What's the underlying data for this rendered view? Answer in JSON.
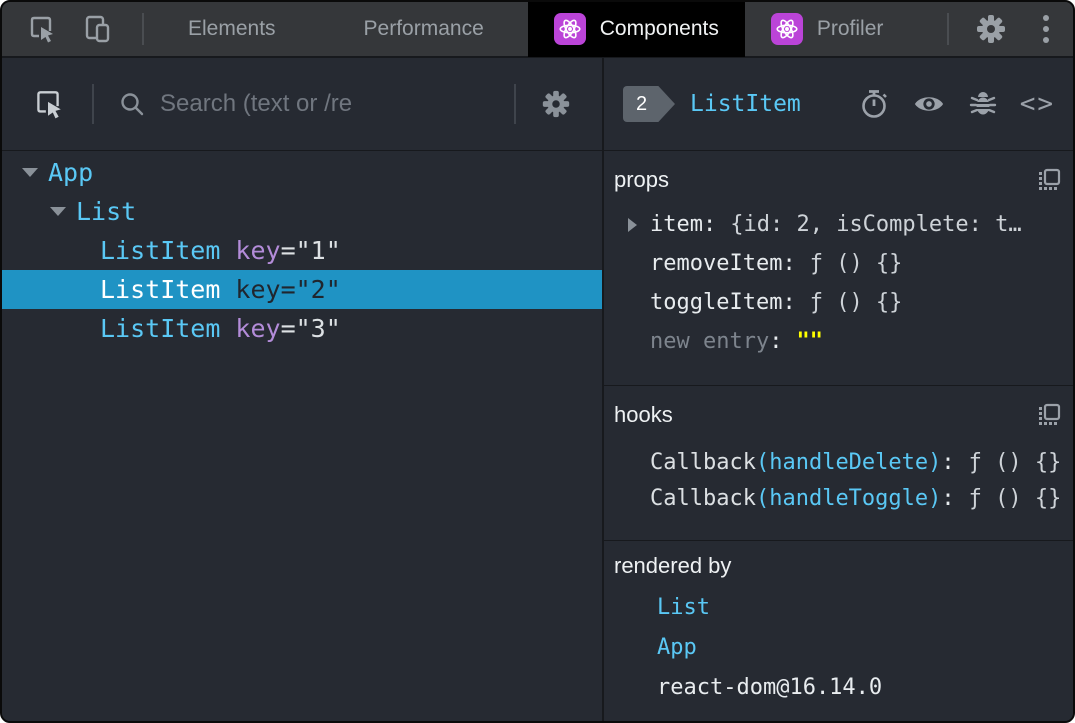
{
  "topbar": {
    "tabs": [
      {
        "label": "Elements"
      },
      {
        "label": "Performance"
      },
      {
        "label": "Components"
      },
      {
        "label": "Profiler"
      }
    ]
  },
  "left_panel": {
    "search_placeholder": "Search (text or /re",
    "tree": [
      {
        "label": "App"
      },
      {
        "label": "List"
      },
      {
        "label": "ListItem",
        "key_name": "key",
        "key_rest": "=\"1\""
      },
      {
        "label": "ListItem",
        "key_name": "key",
        "key_rest": "=\"2\""
      },
      {
        "label": "ListItem",
        "key_name": "key",
        "key_rest": "=\"3\""
      }
    ]
  },
  "right_panel": {
    "badge": "2",
    "component": "ListItem",
    "props": {
      "title": "props",
      "rows": [
        {
          "name": "item",
          "colon": ":",
          "value": "{id: 2, isComplete: t…"
        },
        {
          "name": "removeItem",
          "colon": ":",
          "value": "ƒ () {}"
        },
        {
          "name": "toggleItem",
          "colon": ":",
          "value": "ƒ () {}"
        },
        {
          "name": "new entry",
          "colon": ":",
          "value": "\"\""
        }
      ]
    },
    "hooks": {
      "title": "hooks",
      "rows": [
        {
          "fn": "Callback",
          "call": "(handleDelete)",
          "colon": ":",
          "value": "ƒ () {}"
        },
        {
          "fn": "Callback",
          "call": "(handleToggle)",
          "colon": ":",
          "value": "ƒ () {}"
        }
      ]
    },
    "rendered_by": {
      "title": "rendered by",
      "owners": [
        "List",
        "App"
      ],
      "lib": "react-dom@16.14.0"
    }
  },
  "colors": {
    "accent_cyan": "#5ac8f5",
    "attr_purple": "#b38cd9",
    "selection_blue": "#1f93c4",
    "editable_yellow": "#ffff00",
    "react_icon_purple": "#bb44d8",
    "panel_bg": "#262a32",
    "topbar_bg": "#35373a",
    "active_tab_bg": "#000000"
  }
}
